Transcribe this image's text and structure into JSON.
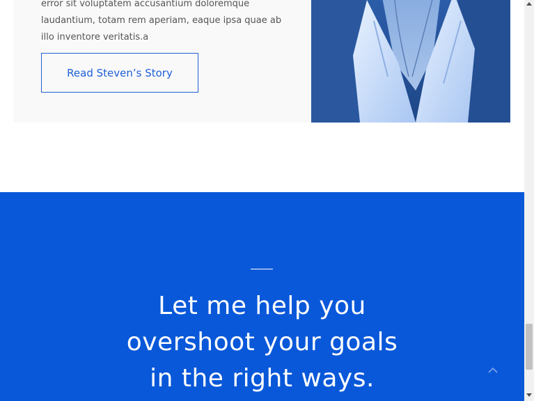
{
  "card": {
    "text_lines": [
      "error sit voluptatem accusantium doloremque",
      "laudantium, totam rem aperiam, eaque ipsa quae ab",
      "illo inventore veritatis.a"
    ],
    "button_label": "Read Steven’s Story"
  },
  "cta": {
    "headline_lines": [
      "Let me help you",
      "overshoot your goals",
      "in the right ways."
    ]
  },
  "icons": {
    "scroll_top": "chevron-up-icon"
  },
  "colors": {
    "accent_blue": "#0958d9",
    "button_blue": "#1e5fd6",
    "card_bg": "#f9f9f9"
  }
}
